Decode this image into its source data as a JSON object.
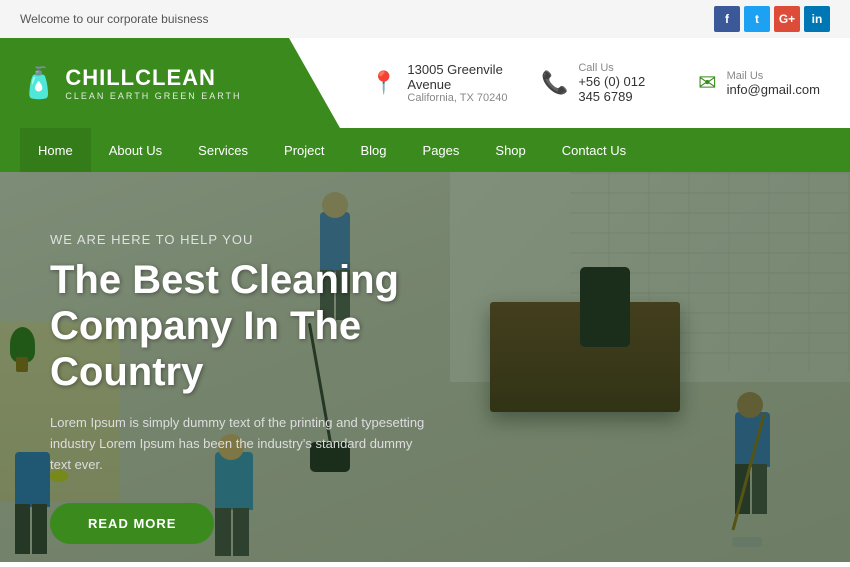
{
  "top_bar": {
    "welcome_text": "Welcome to our corporate buisness",
    "social": [
      {
        "id": "fb",
        "label": "f",
        "class": "social-fb"
      },
      {
        "id": "tw",
        "label": "t",
        "class": "social-tw"
      },
      {
        "id": "gp",
        "label": "G+",
        "class": "social-gp"
      },
      {
        "id": "li",
        "label": "in",
        "class": "social-li"
      }
    ]
  },
  "header": {
    "logo": {
      "brand_name": "CHILLCLEAN",
      "tagline": "CLEAN EARTH GREEN EARTH"
    },
    "contacts": [
      {
        "icon": "📍",
        "icon_type": "loc",
        "label_line1": "13005 Greenvile Avenue",
        "label_line2": "California, TX 70240"
      },
      {
        "icon": "📞",
        "icon_type": "phone",
        "label_line1": "Call Us",
        "label_line2": "+56 (0) 012 345 6789"
      },
      {
        "icon": "✉",
        "icon_type": "mail",
        "label_line1": "Mail Us",
        "label_line2": "info@gmail.com"
      }
    ]
  },
  "nav": {
    "items": [
      {
        "label": "Home",
        "active": true
      },
      {
        "label": "About Us",
        "active": false
      },
      {
        "label": "Services",
        "active": false
      },
      {
        "label": "Project",
        "active": false
      },
      {
        "label": "Blog",
        "active": false
      },
      {
        "label": "Pages",
        "active": false
      },
      {
        "label": "Shop",
        "active": false
      },
      {
        "label": "Contact Us",
        "active": false
      }
    ]
  },
  "hero": {
    "subtitle": "WE ARE HERE TO HELP YOU",
    "title": "The Best Cleaning Company In The Country",
    "description": "Lorem Ipsum is simply dummy text of the printing and typesetting industry Lorem Ipsum has been the industry's standard dummy text ever.",
    "button_label": "READ MORE"
  }
}
